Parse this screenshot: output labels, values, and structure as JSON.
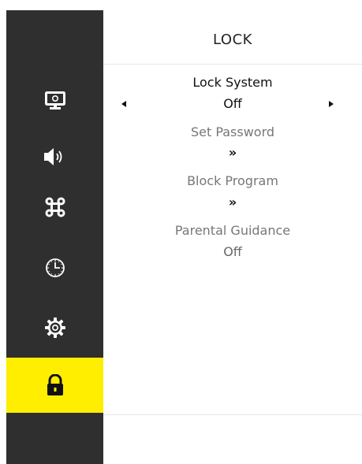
{
  "header": {
    "title": "LOCK"
  },
  "sidebar": {
    "items": [
      {
        "icon": "monitor-icon",
        "active": false
      },
      {
        "icon": "speaker-icon",
        "active": false
      },
      {
        "icon": "command-icon",
        "active": false
      },
      {
        "icon": "clock-icon",
        "active": false
      },
      {
        "icon": "gear-icon",
        "active": false
      },
      {
        "icon": "lock-icon",
        "active": true
      }
    ],
    "active_color": "#ffee00",
    "background_color": "#2f2f2f"
  },
  "menu": {
    "lock_system": {
      "label": "Lock System",
      "value": "Off"
    },
    "set_password": {
      "label": "Set Password",
      "action_glyph": "»"
    },
    "block_program": {
      "label": "Block Program",
      "action_glyph": "»"
    },
    "parental_guidance": {
      "label": "Parental Guidance",
      "value": "Off"
    }
  }
}
